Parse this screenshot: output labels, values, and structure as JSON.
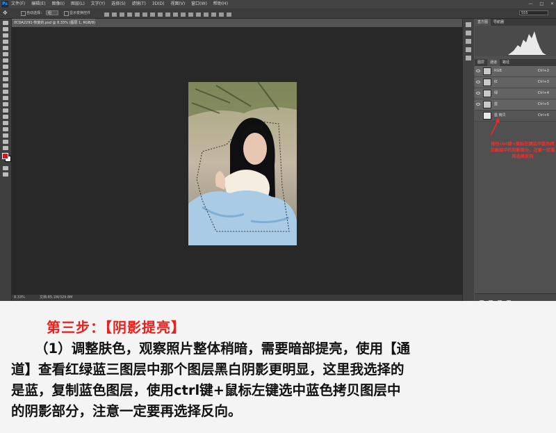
{
  "app": {
    "logo": "Ps",
    "menu": [
      "文件(F)",
      "编辑(E)",
      "图像(I)",
      "图层(L)",
      "文字(Y)",
      "选择(S)",
      "滤镜(T)",
      "3D(D)",
      "视图(V)",
      "窗口(W)",
      "帮助(H)"
    ],
    "window_buttons": [
      "—",
      "□",
      "✕"
    ]
  },
  "options_bar": {
    "auto_select_label": "自动选择：",
    "auto_select_value": "组",
    "show_transform_label": "显示变换控件",
    "workspace_value": "555"
  },
  "document": {
    "tab_title": "0CDA2291-恢复的.psd @ 8.33% (图层 1, RGB/8) *",
    "zoom": "8.33%",
    "doc_info": "文档:85.1M/329.8M"
  },
  "panels": {
    "top_tabs": [
      "直方图",
      "导航器"
    ],
    "channel_tabs": [
      "图层",
      "通道",
      "路径"
    ],
    "channels": [
      {
        "name": "RGB",
        "shortcut": "Ctrl+2"
      },
      {
        "name": "红",
        "shortcut": "Ctrl+3"
      },
      {
        "name": "绿",
        "shortcut": "Ctrl+4"
      },
      {
        "name": "蓝",
        "shortcut": "Ctrl+5"
      },
      {
        "name": "蓝 拷贝",
        "shortcut": "Ctrl+6"
      }
    ],
    "note": "按住ctrl键+鼠标左键选中蓝色拷贝图层中的阴影部分，注意一定要再选择反向"
  },
  "article": {
    "step_title": "第三步：【阴影提亮】",
    "lines": [
      "（1）调整肤色，观察照片整体稍暗，需要暗部提亮，使用【通",
      "道】查看红绿蓝三图层中那个图层黑白阴影更明显，这里我选择的",
      "是蓝，复制蓝色图层，使用ctrl键+鼠标左键选中蓝色拷贝图层中",
      "的阴影部分，注意一定要再选择反向。"
    ]
  },
  "colors": {
    "foreground": "#d11919",
    "background": "#ffffff",
    "title_red": "#e8211c"
  }
}
